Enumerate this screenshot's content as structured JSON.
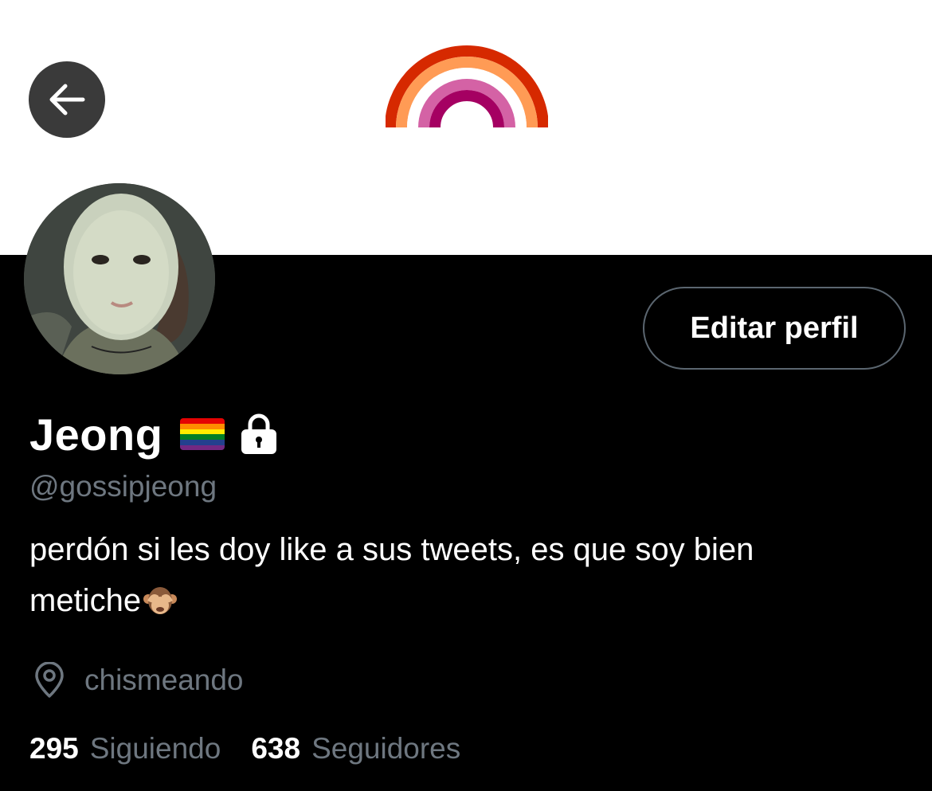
{
  "header": {
    "back_icon": "arrow-left-icon",
    "banner_image": "lesbian-pride-rainbow",
    "banner_colors": [
      "#d62900",
      "#ff9b55",
      "#ffffff",
      "#d462a5",
      "#a50062"
    ]
  },
  "profile": {
    "name": "Jeong",
    "name_emojis": [
      "rainbow-flag-icon",
      "lock-icon"
    ],
    "handle": "@gossipjeong",
    "bio_line1": "perdón si les doy like a sus tweets, es que soy bien",
    "bio_line2": "metiche",
    "bio_emoji": "see-no-evil-monkey-icon",
    "location_icon": "location-pin-icon",
    "location": "chismeando",
    "edit_button": "Editar perfil"
  },
  "stats": {
    "following_count": "295",
    "following_label": "Siguiendo",
    "followers_count": "638",
    "followers_label": "Seguidores"
  }
}
